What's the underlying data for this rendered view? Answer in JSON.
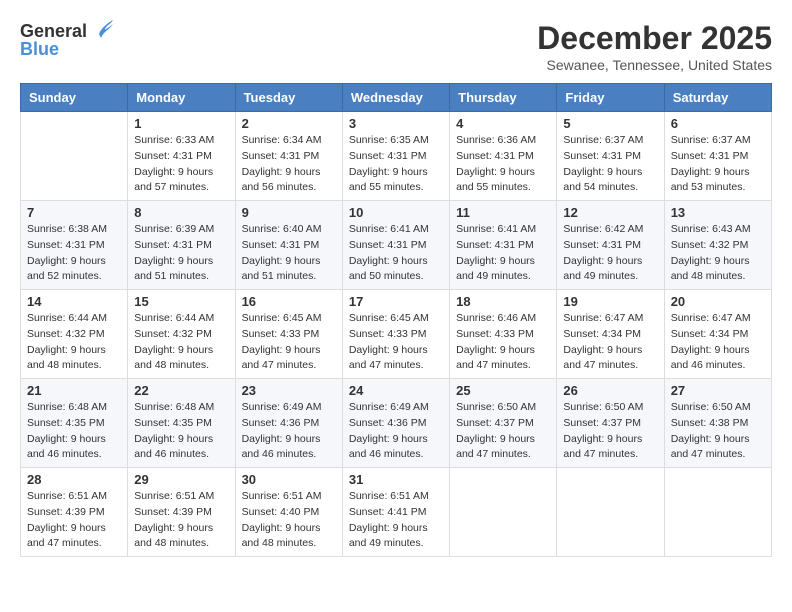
{
  "header": {
    "logo_general": "General",
    "logo_blue": "Blue",
    "month_title": "December 2025",
    "location": "Sewanee, Tennessee, United States"
  },
  "days_of_week": [
    "Sunday",
    "Monday",
    "Tuesday",
    "Wednesday",
    "Thursday",
    "Friday",
    "Saturday"
  ],
  "weeks": [
    [
      {
        "day": "",
        "sunrise": "",
        "sunset": "",
        "daylight": ""
      },
      {
        "day": "1",
        "sunrise": "Sunrise: 6:33 AM",
        "sunset": "Sunset: 4:31 PM",
        "daylight": "Daylight: 9 hours and 57 minutes."
      },
      {
        "day": "2",
        "sunrise": "Sunrise: 6:34 AM",
        "sunset": "Sunset: 4:31 PM",
        "daylight": "Daylight: 9 hours and 56 minutes."
      },
      {
        "day": "3",
        "sunrise": "Sunrise: 6:35 AM",
        "sunset": "Sunset: 4:31 PM",
        "daylight": "Daylight: 9 hours and 55 minutes."
      },
      {
        "day": "4",
        "sunrise": "Sunrise: 6:36 AM",
        "sunset": "Sunset: 4:31 PM",
        "daylight": "Daylight: 9 hours and 55 minutes."
      },
      {
        "day": "5",
        "sunrise": "Sunrise: 6:37 AM",
        "sunset": "Sunset: 4:31 PM",
        "daylight": "Daylight: 9 hours and 54 minutes."
      },
      {
        "day": "6",
        "sunrise": "Sunrise: 6:37 AM",
        "sunset": "Sunset: 4:31 PM",
        "daylight": "Daylight: 9 hours and 53 minutes."
      }
    ],
    [
      {
        "day": "7",
        "sunrise": "Sunrise: 6:38 AM",
        "sunset": "Sunset: 4:31 PM",
        "daylight": "Daylight: 9 hours and 52 minutes."
      },
      {
        "day": "8",
        "sunrise": "Sunrise: 6:39 AM",
        "sunset": "Sunset: 4:31 PM",
        "daylight": "Daylight: 9 hours and 51 minutes."
      },
      {
        "day": "9",
        "sunrise": "Sunrise: 6:40 AM",
        "sunset": "Sunset: 4:31 PM",
        "daylight": "Daylight: 9 hours and 51 minutes."
      },
      {
        "day": "10",
        "sunrise": "Sunrise: 6:41 AM",
        "sunset": "Sunset: 4:31 PM",
        "daylight": "Daylight: 9 hours and 50 minutes."
      },
      {
        "day": "11",
        "sunrise": "Sunrise: 6:41 AM",
        "sunset": "Sunset: 4:31 PM",
        "daylight": "Daylight: 9 hours and 49 minutes."
      },
      {
        "day": "12",
        "sunrise": "Sunrise: 6:42 AM",
        "sunset": "Sunset: 4:31 PM",
        "daylight": "Daylight: 9 hours and 49 minutes."
      },
      {
        "day": "13",
        "sunrise": "Sunrise: 6:43 AM",
        "sunset": "Sunset: 4:32 PM",
        "daylight": "Daylight: 9 hours and 48 minutes."
      }
    ],
    [
      {
        "day": "14",
        "sunrise": "Sunrise: 6:44 AM",
        "sunset": "Sunset: 4:32 PM",
        "daylight": "Daylight: 9 hours and 48 minutes."
      },
      {
        "day": "15",
        "sunrise": "Sunrise: 6:44 AM",
        "sunset": "Sunset: 4:32 PM",
        "daylight": "Daylight: 9 hours and 48 minutes."
      },
      {
        "day": "16",
        "sunrise": "Sunrise: 6:45 AM",
        "sunset": "Sunset: 4:33 PM",
        "daylight": "Daylight: 9 hours and 47 minutes."
      },
      {
        "day": "17",
        "sunrise": "Sunrise: 6:45 AM",
        "sunset": "Sunset: 4:33 PM",
        "daylight": "Daylight: 9 hours and 47 minutes."
      },
      {
        "day": "18",
        "sunrise": "Sunrise: 6:46 AM",
        "sunset": "Sunset: 4:33 PM",
        "daylight": "Daylight: 9 hours and 47 minutes."
      },
      {
        "day": "19",
        "sunrise": "Sunrise: 6:47 AM",
        "sunset": "Sunset: 4:34 PM",
        "daylight": "Daylight: 9 hours and 47 minutes."
      },
      {
        "day": "20",
        "sunrise": "Sunrise: 6:47 AM",
        "sunset": "Sunset: 4:34 PM",
        "daylight": "Daylight: 9 hours and 46 minutes."
      }
    ],
    [
      {
        "day": "21",
        "sunrise": "Sunrise: 6:48 AM",
        "sunset": "Sunset: 4:35 PM",
        "daylight": "Daylight: 9 hours and 46 minutes."
      },
      {
        "day": "22",
        "sunrise": "Sunrise: 6:48 AM",
        "sunset": "Sunset: 4:35 PM",
        "daylight": "Daylight: 9 hours and 46 minutes."
      },
      {
        "day": "23",
        "sunrise": "Sunrise: 6:49 AM",
        "sunset": "Sunset: 4:36 PM",
        "daylight": "Daylight: 9 hours and 46 minutes."
      },
      {
        "day": "24",
        "sunrise": "Sunrise: 6:49 AM",
        "sunset": "Sunset: 4:36 PM",
        "daylight": "Daylight: 9 hours and 46 minutes."
      },
      {
        "day": "25",
        "sunrise": "Sunrise: 6:50 AM",
        "sunset": "Sunset: 4:37 PM",
        "daylight": "Daylight: 9 hours and 47 minutes."
      },
      {
        "day": "26",
        "sunrise": "Sunrise: 6:50 AM",
        "sunset": "Sunset: 4:37 PM",
        "daylight": "Daylight: 9 hours and 47 minutes."
      },
      {
        "day": "27",
        "sunrise": "Sunrise: 6:50 AM",
        "sunset": "Sunset: 4:38 PM",
        "daylight": "Daylight: 9 hours and 47 minutes."
      }
    ],
    [
      {
        "day": "28",
        "sunrise": "Sunrise: 6:51 AM",
        "sunset": "Sunset: 4:39 PM",
        "daylight": "Daylight: 9 hours and 47 minutes."
      },
      {
        "day": "29",
        "sunrise": "Sunrise: 6:51 AM",
        "sunset": "Sunset: 4:39 PM",
        "daylight": "Daylight: 9 hours and 48 minutes."
      },
      {
        "day": "30",
        "sunrise": "Sunrise: 6:51 AM",
        "sunset": "Sunset: 4:40 PM",
        "daylight": "Daylight: 9 hours and 48 minutes."
      },
      {
        "day": "31",
        "sunrise": "Sunrise: 6:51 AM",
        "sunset": "Sunset: 4:41 PM",
        "daylight": "Daylight: 9 hours and 49 minutes."
      },
      {
        "day": "",
        "sunrise": "",
        "sunset": "",
        "daylight": ""
      },
      {
        "day": "",
        "sunrise": "",
        "sunset": "",
        "daylight": ""
      },
      {
        "day": "",
        "sunrise": "",
        "sunset": "",
        "daylight": ""
      }
    ]
  ]
}
